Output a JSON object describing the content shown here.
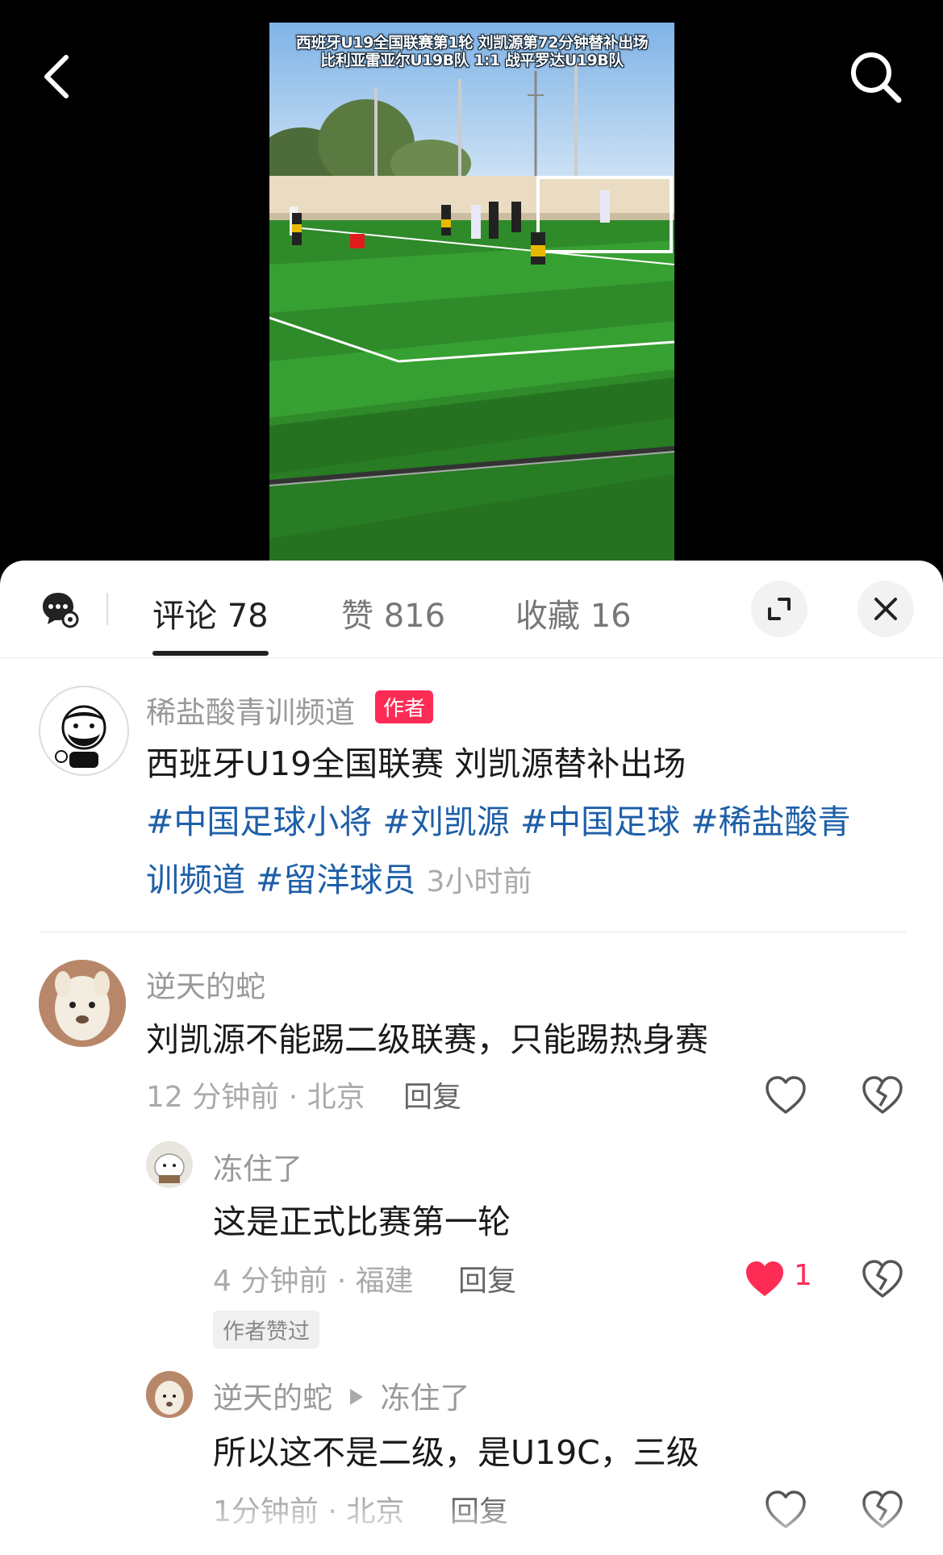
{
  "video": {
    "caption_line1": "西班牙U19全国联赛第1轮 刘凯源第72分钟替补出场",
    "caption_line2": "比利亚雷亚尔U19B队 1:1 战平罗达U19B队"
  },
  "nav": {
    "back_icon": "chevron-left-icon",
    "search_icon": "search-icon"
  },
  "tabs": [
    {
      "label": "评论",
      "count": "78"
    },
    {
      "label": "赞",
      "count": "816"
    },
    {
      "label": "收藏",
      "count": "16"
    }
  ],
  "post": {
    "author": "稀盐酸青训频道",
    "author_badge": "作者",
    "title": "西班牙U19全国联赛 刘凯源替补出场",
    "tags": [
      "#中国足球小将",
      "#刘凯源",
      "#中国足球",
      "#稀盐酸青",
      "训频道",
      "#留洋球员"
    ],
    "time": "3小时前"
  },
  "comments": [
    {
      "user": "逆天的蛇",
      "text": "刘凯源不能踢二级联赛，只能踢热身赛",
      "meta": "12 分钟前 · 北京",
      "reply_label": "回复"
    },
    {
      "user": "冻住了",
      "text": "这是正式比赛第一轮",
      "meta": "4 分钟前 · 福建",
      "reply_label": "回复",
      "likes": "1",
      "liked": true,
      "author_liked_label": "作者赞过"
    },
    {
      "user": "逆天的蛇",
      "reply_to": "冻住了",
      "text": "所以这不是二级，是U19C，三级",
      "meta": "1分钟前 · 北京",
      "reply_label": "回复"
    }
  ],
  "colors": {
    "like_red": "#fe2c55",
    "tag_blue": "#1e5fa8",
    "sheet_bg": "#ffffff"
  }
}
